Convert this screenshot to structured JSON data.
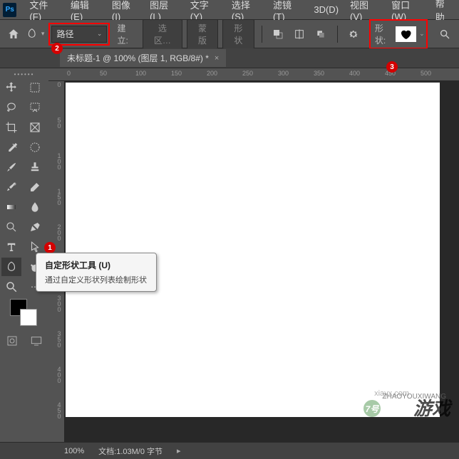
{
  "menu": [
    "文件(F)",
    "编辑(E)",
    "图像(I)",
    "图层(L)",
    "文字(Y)",
    "选择(S)",
    "滤镜(T)",
    "3D(D)",
    "视图(V)",
    "窗口(W)",
    "帮助"
  ],
  "optionbar": {
    "mode": "路径",
    "build_label": "建立:",
    "btn_selection": "选区…",
    "btn_mask": "蒙版",
    "btn_shape": "形状",
    "shape_label": "形状:"
  },
  "badges": {
    "b1": "1",
    "b2": "2",
    "b3": "3"
  },
  "tab": {
    "title": "未标题-1 @ 100% (图层 1, RGB/8#) *"
  },
  "ruler_h": [
    "0",
    "50",
    "100",
    "150",
    "200",
    "250",
    "300",
    "350",
    "400",
    "450",
    "500"
  ],
  "ruler_v": [
    "0",
    "50",
    "100",
    "150",
    "200",
    "250",
    "300",
    "350",
    "400",
    "450"
  ],
  "tooltip": {
    "title": "自定形状工具 (U)",
    "desc": "通过自定义形状列表绘制形状"
  },
  "status": {
    "zoom": "100%",
    "doc": "文档:1.03M/0 字节"
  },
  "watermark": {
    "main": "游戏",
    "sub": "ZHAOYOUXIWANG",
    "url": "xiayx.com",
    "num": "7号"
  }
}
